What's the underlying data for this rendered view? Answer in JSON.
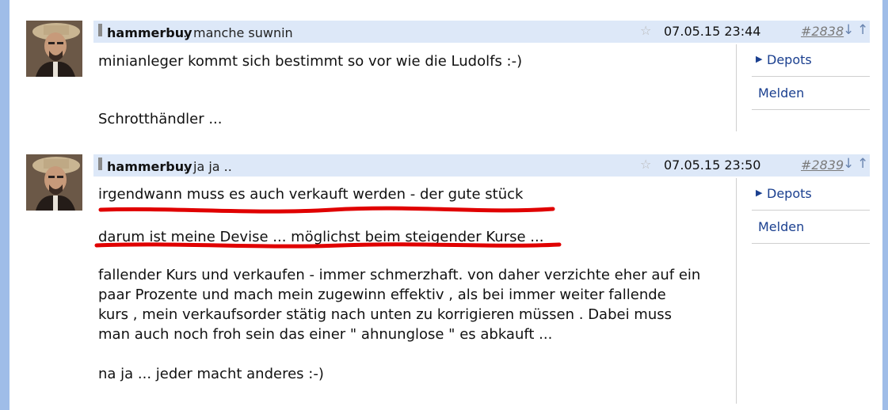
{
  "posts": [
    {
      "username": "hammerbuy",
      "separator": ":",
      "subject": "manche suwnin",
      "datetime": "07.05.15 23:44",
      "post_number": "#2838",
      "paragraphs": [
        "minianleger kommt sich bestimmt so vor wie die Ludolfs :-)",
        "",
        "Schrotthändler ..."
      ],
      "sidebar": {
        "depots": "Depots",
        "melden": "Melden"
      }
    },
    {
      "username": "hammerbuy",
      "separator": ":",
      "subject": "ja ja ..",
      "datetime": "07.05.15 23:50",
      "post_number": "#2839",
      "paragraphs": [
        "irgendwann muss es auch verkauft werden - der gute stück",
        "darum ist meine Devise ... möglichst beim steigender Kurse ...",
        "fallender Kurs  und verkaufen - immer schmerzhaft. von daher verzichte eher auf ein",
        "paar Prozente und mach mein zugewinn effektiv , als bei immer weiter fallende",
        "kurs , mein verkaufsorder stätig nach unten zu  korrigieren müssen . Dabei muss",
        "man auch noch froh sein das einer \" ahnunglose \" es abkauft ...",
        "na ja ... jeder macht anderes :-)"
      ],
      "sidebar": {
        "depots": "Depots",
        "melden": "Melden"
      }
    }
  ],
  "icons": {
    "star": "star-outline-icon",
    "arrow_down": "arrow-down-icon",
    "arrow_up": "arrow-up-icon",
    "caret": "caret-right-icon"
  },
  "colors": {
    "header_bg": "#dde8f8",
    "link": "#1a3f8f",
    "annotation": "#e00000",
    "rail": "#9fbde8"
  }
}
